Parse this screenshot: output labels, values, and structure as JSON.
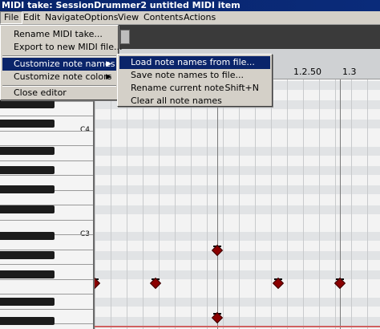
{
  "window": {
    "title": "MIDI take: SessionDrummer2 untitled MIDI item"
  },
  "menubar": [
    {
      "label": "File"
    },
    {
      "label": "Edit"
    },
    {
      "label": "Navigate"
    },
    {
      "label": "Options"
    },
    {
      "label": "View"
    },
    {
      "label": "Contents"
    },
    {
      "label": "Actions"
    }
  ],
  "file_menu": {
    "items": [
      {
        "label": "Rename MIDI take..."
      },
      {
        "label": "Export to new MIDI file..."
      },
      {
        "label": "Customize note names",
        "submenu": true
      },
      {
        "label": "Customize note colors",
        "submenu": true
      },
      {
        "label": "Close editor"
      }
    ]
  },
  "submenu": {
    "items": [
      {
        "label": "Load note names from file..."
      },
      {
        "label": "Save note names to file..."
      },
      {
        "label": "Rename current note",
        "shortcut": "Shift+N"
      },
      {
        "label": "Clear all note names"
      }
    ]
  },
  "ruler": {
    "ticks": [
      "1.2.50",
      "1.3"
    ]
  },
  "keyboard": {
    "labels": [
      "C4",
      "C3"
    ]
  },
  "icons": {
    "submenu_arrow": "triangle-right-icon"
  },
  "colors": {
    "highlight": "#0a246a",
    "note": "#8b0000",
    "titlebar": "#08246b"
  }
}
